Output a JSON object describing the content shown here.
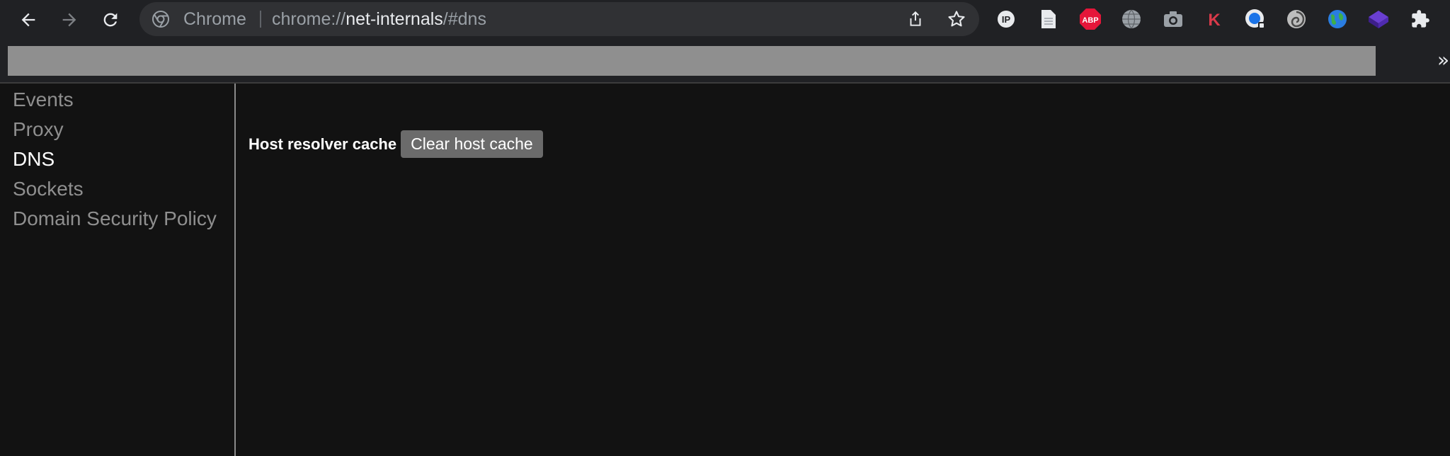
{
  "browser": {
    "omnibox": {
      "site_label": "Chrome",
      "url_scheme": "chrome://",
      "url_host": "net-internals",
      "url_path": "/#dns"
    },
    "extensions": [
      "ip-icon",
      "document-icon",
      "adblock-plus-icon",
      "globe-icon",
      "camera-icon",
      "k-icon",
      "security-icon",
      "swirl-icon",
      "earth-icon",
      "cube-icon",
      "puzzle-icon"
    ],
    "bookmarks_overflow": "»"
  },
  "sidebar": {
    "items": [
      {
        "label": "Events",
        "active": false
      },
      {
        "label": "Proxy",
        "active": false
      },
      {
        "label": "DNS",
        "active": true
      },
      {
        "label": "Sockets",
        "active": false
      },
      {
        "label": "Domain Security Policy",
        "active": false
      }
    ]
  },
  "main": {
    "section_label": "Host resolver cache",
    "clear_button_label": "Clear host cache"
  }
}
